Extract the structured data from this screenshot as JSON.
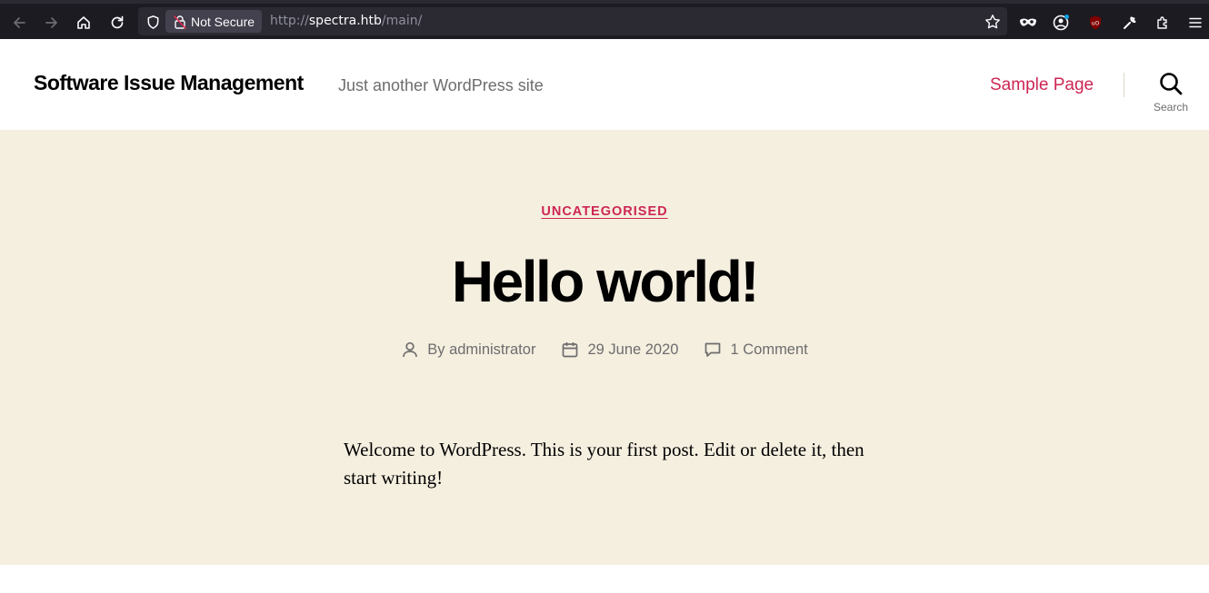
{
  "browser": {
    "not_secure_label": "Not Secure",
    "url_scheme": "http://",
    "url_host": "spectra.htb",
    "url_path": "/main/"
  },
  "header": {
    "site_title": "Software Issue Management",
    "site_description": "Just another WordPress site",
    "nav_items": [
      "Sample Page"
    ],
    "search_label": "Search"
  },
  "post": {
    "category": "UNCATEGORISED",
    "title": "Hello world!",
    "author": "By administrator",
    "date": "29 June 2020",
    "comments": "1 Comment",
    "content": "Welcome to WordPress. This is your first post. Edit or delete it, then start writing!"
  },
  "colors": {
    "accent": "#cd2653",
    "hero_background": "#f5efe0",
    "toolbar_background": "#1c1b22"
  },
  "icons": [
    "back-icon",
    "forward-icon",
    "home-icon",
    "reload-icon",
    "shield-icon",
    "lock-warning-icon",
    "bookmark-star-icon",
    "private-mask-icon",
    "account-icon",
    "ublock-icon",
    "wrench-icon",
    "extensions-icon",
    "menu-icon",
    "search-icon",
    "user-icon",
    "calendar-icon",
    "comment-icon"
  ]
}
